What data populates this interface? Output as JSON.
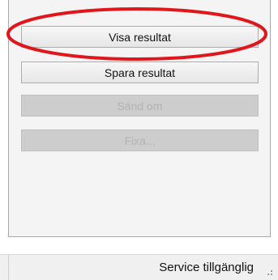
{
  "buttons": {
    "visa_resultat": "Visa resultat",
    "spara_resultat": "Spara resultat",
    "sand_om": "Sänd om",
    "fixa": "Fixa..."
  },
  "statusbar": {
    "text": "Service tillgänglig"
  },
  "colors": {
    "highlight_ring": "#e0161b",
    "disabled_button": "#cdcdcd",
    "panel_background": "#f4f4f4"
  },
  "icons": {
    "resize_grip": "resize-grip-icon"
  }
}
